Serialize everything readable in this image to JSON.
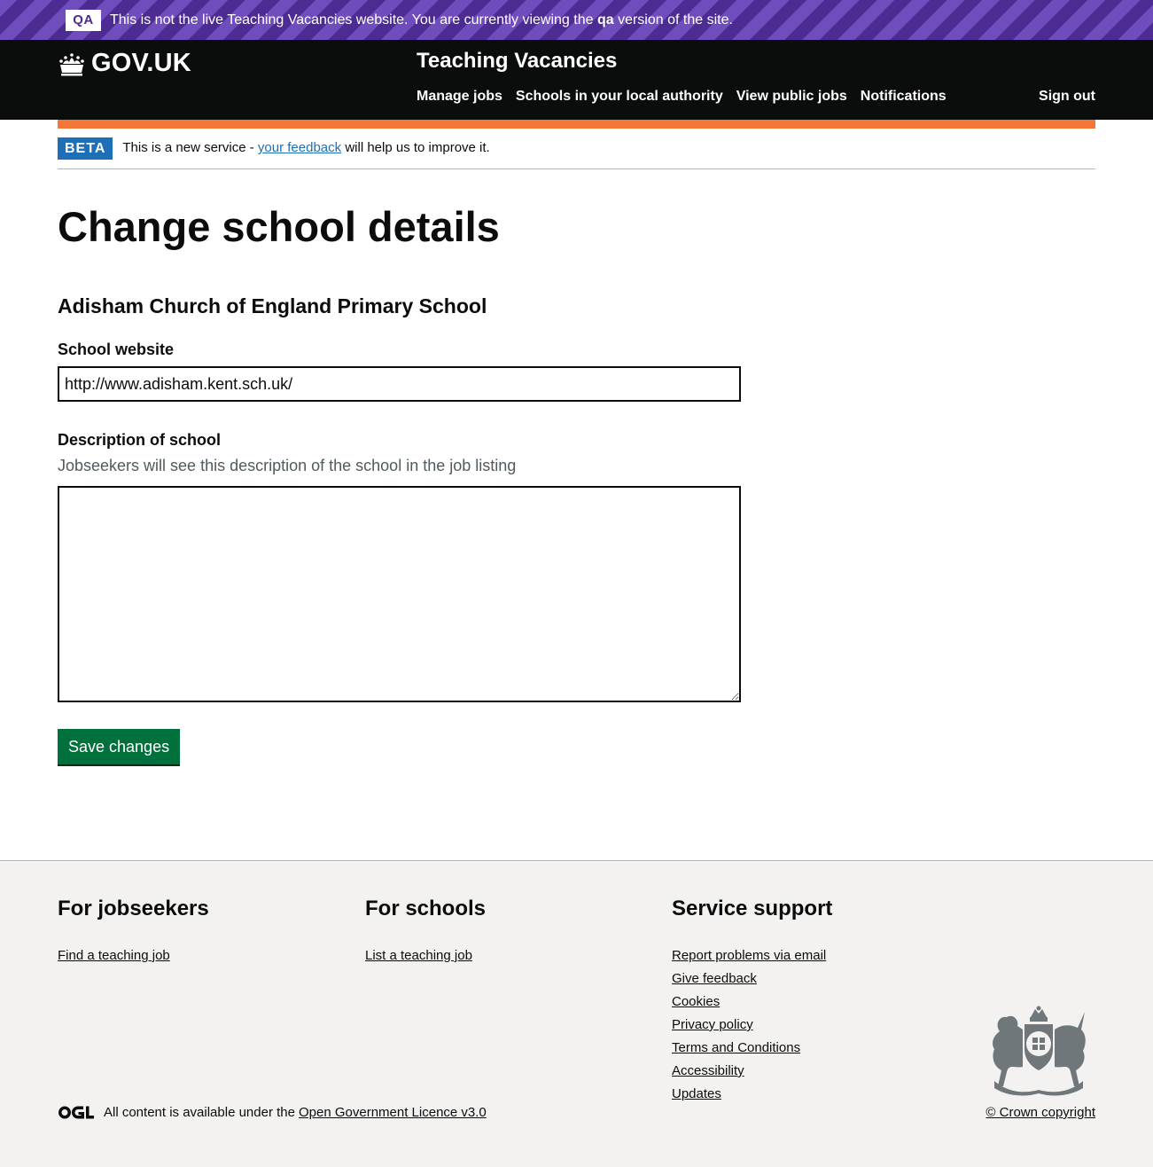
{
  "qa_banner": {
    "tag": "QA",
    "text_before": "This is not the live Teaching Vacancies website. You are currently viewing the",
    "text_bold": "qa",
    "text_after": "version of the site."
  },
  "header": {
    "logo_text": "GOV.UK",
    "service_name": "Teaching Vacancies",
    "nav": [
      "Manage jobs",
      "Schools in your local authority",
      "View public jobs",
      "Notifications"
    ],
    "sign_out": "Sign out"
  },
  "phase_banner": {
    "tag": "BETA",
    "text_before": "This is a new service -",
    "link": "your feedback",
    "text_after": "will help us to improve it."
  },
  "main": {
    "title": "Change school details",
    "school_name": "Adisham Church of England Primary School",
    "website_label": "School website",
    "website_value": "http://www.adisham.kent.sch.uk/",
    "description_label": "Description of school",
    "description_hint": "Jobseekers will see this description of the school in the job listing",
    "description_value": "",
    "save_button": "Save changes"
  },
  "footer": {
    "jobseekers": {
      "heading": "For jobseekers",
      "links": [
        "Find a teaching job"
      ]
    },
    "schools": {
      "heading": "For schools",
      "links": [
        "List a teaching job"
      ]
    },
    "support": {
      "heading": "Service support",
      "links": [
        "Report problems via email",
        "Give feedback",
        "Cookies",
        "Privacy policy",
        "Terms and Conditions",
        "Accessibility",
        "Updates"
      ]
    },
    "licence_text": "All content is available under the",
    "licence_link": "Open Government Licence v3.0",
    "copyright": "© Crown copyright"
  },
  "colors": {
    "qa_purple": "#4c2c92",
    "header_black": "#0b0c0c",
    "accent_orange": "#f47738",
    "beta_blue": "#1d70b8",
    "button_green": "#00703c",
    "footer_bg": "#f3f2f1"
  },
  "icons": {
    "logo": "crown-icon",
    "licence": "ogl-logo-icon",
    "crest": "royal-coat-of-arms-icon"
  }
}
